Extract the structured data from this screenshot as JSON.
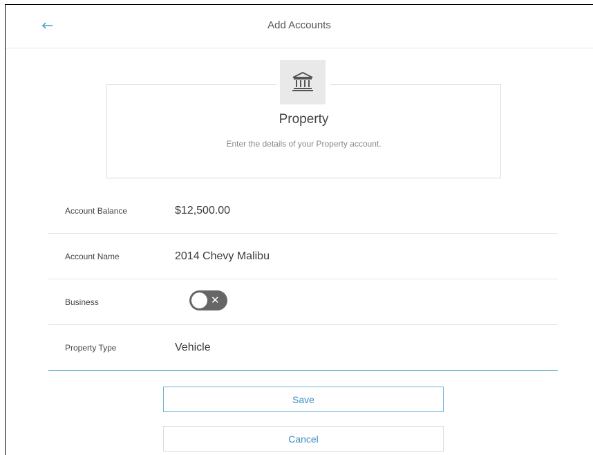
{
  "header": {
    "title": "Add Accounts",
    "back_icon": "arrow-left-icon"
  },
  "card": {
    "icon": "bank-icon",
    "title": "Property",
    "subtitle": "Enter the details of your Property account."
  },
  "form": {
    "rows": [
      {
        "label": "Account Balance",
        "value": "$12,500.00"
      },
      {
        "label": "Account Name",
        "value": "2014 Chevy Malibu"
      },
      {
        "label": "Business",
        "toggle_on": false
      },
      {
        "label": "Property Type",
        "value": "Vehicle"
      }
    ]
  },
  "actions": {
    "save_label": "Save",
    "cancel_label": "Cancel"
  },
  "colors": {
    "accent": "#3a8fc1",
    "toggle_off": "#666666"
  }
}
